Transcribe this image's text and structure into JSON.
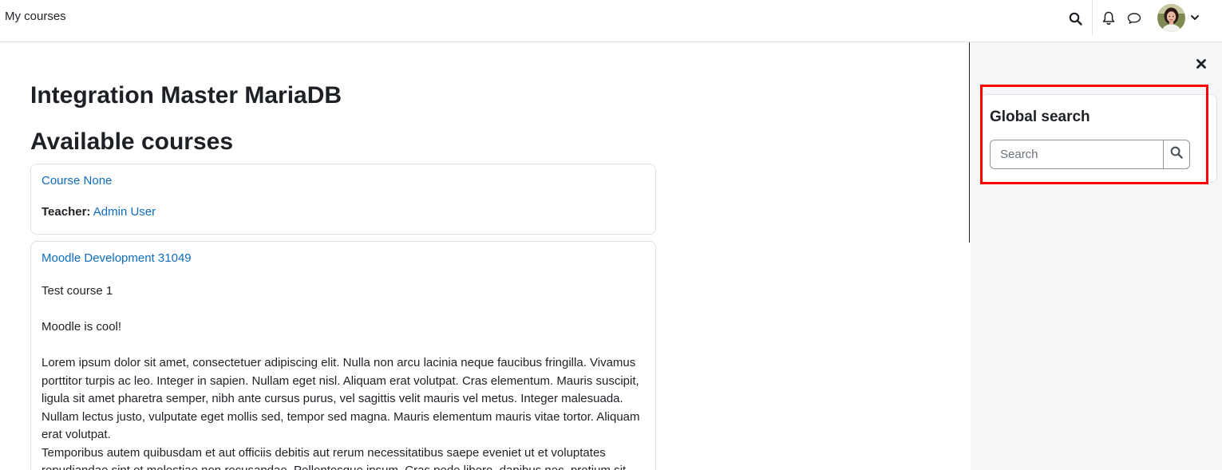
{
  "navbar": {
    "my_courses_label": "My courses",
    "icons": [
      "search-icon",
      "bell-icon",
      "chat-icon",
      "avatar",
      "chevron-down-icon"
    ]
  },
  "main": {
    "site_title": "Integration Master MariaDB",
    "section_title": "Available courses",
    "courses": [
      {
        "name": "Course None",
        "teacher_label": "Teacher:",
        "teacher_name": "Admin User"
      },
      {
        "name": "Moodle Development 31049",
        "summary": [
          "Test course 1",
          "Moodle is cool!",
          "Lorem ipsum dolor sit amet, consectetuer adipiscing elit. Nulla non arcu lacinia neque faucibus fringilla. Vivamus porttitor turpis ac leo. Integer in sapien. Nullam eget nisl. Aliquam erat volutpat. Cras elementum. Mauris suscipit, ligula sit amet pharetra semper, nibh ante cursus purus, vel sagittis velit mauris vel metus. Integer malesuada. Nullam lectus justo, vulputate eget mollis sed, tempor sed magna. Mauris elementum mauris vitae tortor. Aliquam erat volutpat.",
          "Temporibus autem quibusdam et aut officiis debitis aut rerum necessitatibus saepe eveniet ut et voluptates repudiandae sint et molestiae non recusandae. Pellentesque ipsum. Cras pede libero, dapibus nec, pretium sit"
        ]
      }
    ]
  },
  "drawer": {
    "close_icon": "close-icon",
    "block_title": "Global search",
    "search_placeholder": "Search"
  },
  "colors": {
    "link": "#0f6cbf",
    "text": "#1d2125",
    "drawer_bg": "#f5f6f8",
    "highlight": "#ff0000"
  }
}
